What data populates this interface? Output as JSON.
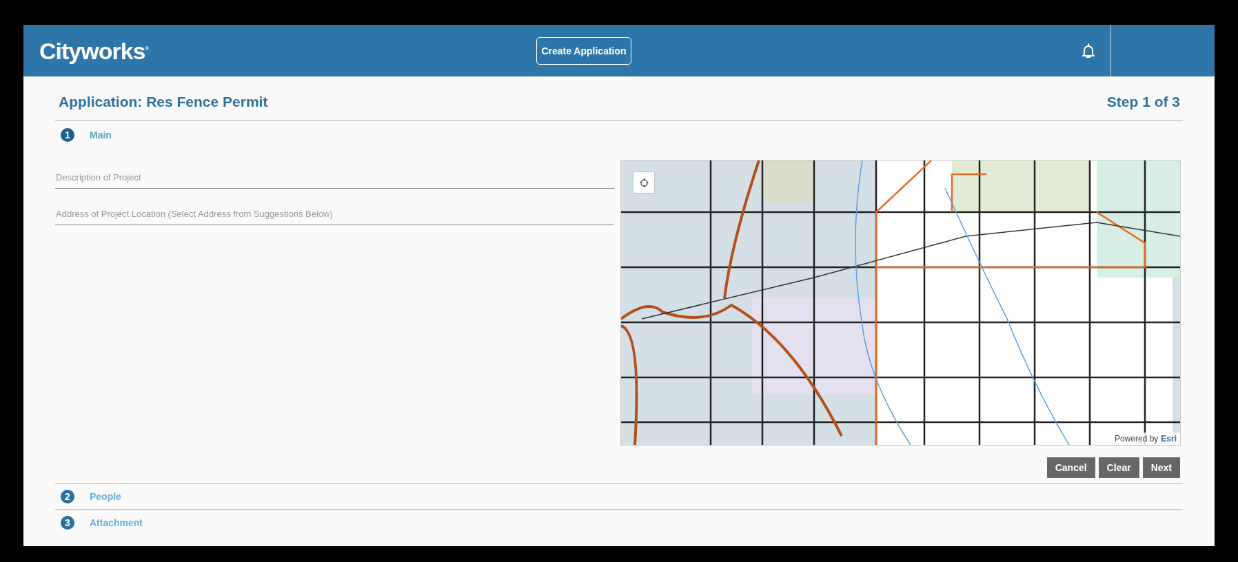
{
  "header": {
    "logo": "Cityworks",
    "logo_mark": "®",
    "create_button": "Create Application"
  },
  "page": {
    "title": "Application: Res Fence Permit",
    "step_counter": "Step 1 of 3"
  },
  "steps": [
    {
      "number": "1",
      "label": "Main",
      "expanded": true
    },
    {
      "number": "2",
      "label": "People",
      "expanded": false
    },
    {
      "number": "3",
      "label": "Attachment",
      "expanded": false
    }
  ],
  "form": {
    "fields": [
      {
        "placeholder": "Description of Project"
      },
      {
        "placeholder": "Address of Project Location (Select Address from Suggestions Below)"
      }
    ],
    "map": {
      "kind": "picture",
      "attribution_prefix": "Powered by",
      "attribution_link": "Esri"
    },
    "buttons": [
      "Cancel",
      "Clear",
      "Next"
    ]
  }
}
